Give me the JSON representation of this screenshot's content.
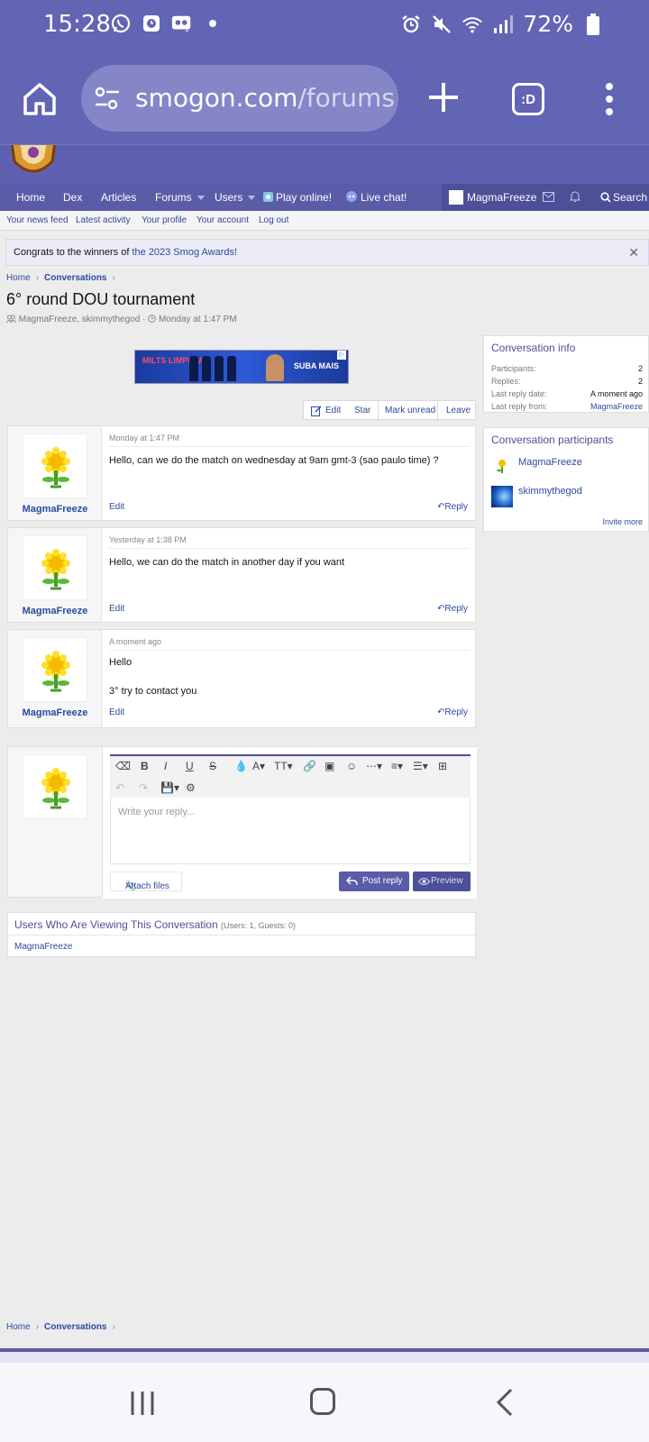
{
  "status_bar": {
    "time": "15:28",
    "battery": "72%",
    "left_icons": [
      "whatsapp-icon",
      "clock-app-icon",
      "voicemail-icon",
      "dot-icon"
    ],
    "right_icons": [
      "alarm-icon",
      "mute-icon",
      "wifi-icon",
      "signal-icon",
      "battery-icon"
    ]
  },
  "browser": {
    "url_host": "smogon.com",
    "url_path": "/forums",
    "tabs_label": ":D"
  },
  "nav": {
    "items": [
      "Home",
      "Dex",
      "Articles",
      "Forums",
      "Users",
      "Play online!",
      "Live chat!"
    ],
    "user": "MagmaFreeze",
    "search": "Search"
  },
  "subnav": [
    "Your news feed",
    "Latest activity",
    "Your profile",
    "Your account",
    "Log out"
  ],
  "notice": {
    "text": "Congrats to the winners of ",
    "link": "the 2023 Smog Awards!"
  },
  "breadcrumb": {
    "home": "Home",
    "current": "Conversations"
  },
  "conversation": {
    "title": "6° round DOU tournament",
    "participants_line": "MagmaFreeze, skimmythegod",
    "date": "Monday at 1:47 PM"
  },
  "ad": {
    "left_text": "MILTS LIMPEZA",
    "right_text": "SUBA MAIS",
    "corner": "▷"
  },
  "actions": {
    "edit": "Edit",
    "star": "Star",
    "mark_unread": "Mark unread",
    "leave": "Leave"
  },
  "messages": [
    {
      "author": "MagmaFreeze",
      "date": "Monday at 1:47 PM",
      "lines": [
        "Hello, can we do the match on wednesday at 9am gmt-3 (sao paulo time) ?"
      ],
      "edit": "Edit",
      "reply": "Reply"
    },
    {
      "author": "MagmaFreeze",
      "date": "Yesterday at 1:38 PM",
      "lines": [
        "Hello, we can do the match in another day if you want"
      ],
      "edit": "Edit",
      "reply": "Reply"
    },
    {
      "author": "MagmaFreeze",
      "date": "A moment ago",
      "lines": [
        "Hello",
        "3° try to contact you"
      ],
      "edit": "Edit",
      "reply": "Reply"
    }
  ],
  "sidebar": {
    "info": {
      "title": "Conversation info",
      "rows": [
        {
          "label": "Participants:",
          "value": "2"
        },
        {
          "label": "Replies:",
          "value": "2"
        },
        {
          "label": "Last reply date:",
          "value": "A moment ago"
        },
        {
          "label": "Last reply from:",
          "value": "MagmaFreeze"
        }
      ]
    },
    "participants": {
      "title": "Conversation participants",
      "users": [
        "MagmaFreeze",
        "skimmythegod"
      ],
      "invite": "Invite more"
    }
  },
  "editor": {
    "placeholder": "Write your reply...",
    "attach": "Attach files",
    "post": "Post reply",
    "preview": "Preview"
  },
  "viewers": {
    "title": "Users Who Are Viewing This Conversation",
    "counts": "(Users: 1, Guests: 0)",
    "users": [
      "MagmaFreeze"
    ]
  },
  "colors": {
    "brand": "#6264b4",
    "link": "#2b4aa0",
    "nav": "#5a5ca8"
  }
}
